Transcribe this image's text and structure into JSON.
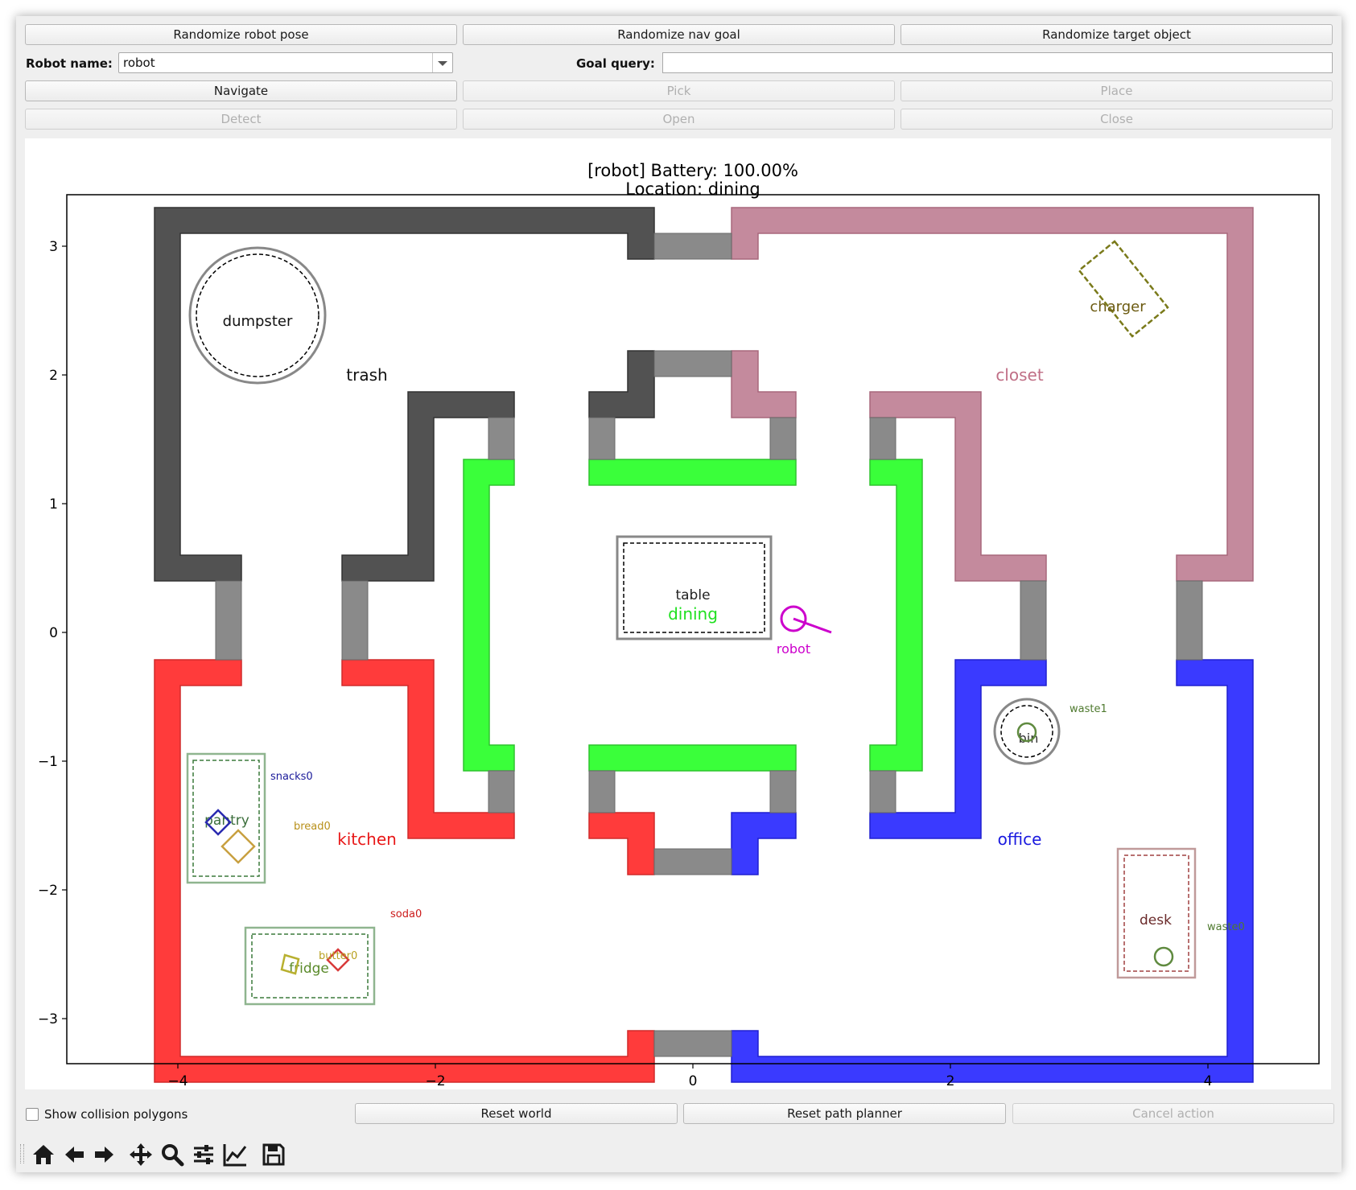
{
  "controls": {
    "randomize_pose": "Randomize robot pose",
    "randomize_goal": "Randomize nav goal",
    "randomize_object": "Randomize target object",
    "robot_name_label": "Robot name:",
    "robot_name_value": "robot",
    "goal_query_label": "Goal query:",
    "goal_query_value": "",
    "navigate": "Navigate",
    "pick": "Pick",
    "place": "Place",
    "detect": "Detect",
    "open": "Open",
    "close": "Close"
  },
  "plot": {
    "title_line1": "[robot] Battery: 100.00%",
    "title_line2": "Location: dining",
    "xticks": [
      "−4",
      "−2",
      "0",
      "2",
      "4"
    ],
    "yticks": [
      "3",
      "2",
      "1",
      "0",
      "−1",
      "−2",
      "−3"
    ],
    "rooms": {
      "trash": "trash",
      "closet": "closet",
      "kitchen": "kitchen",
      "office": "office",
      "dining": "dining"
    },
    "locations": {
      "dumpster": "dumpster",
      "charger": "charger",
      "table": "table",
      "bin": "bin",
      "pantry": "pantry",
      "fridge": "fridge",
      "desk": "desk"
    },
    "objects": {
      "snacks0": "snacks0",
      "bread0": "bread0",
      "soda0": "soda0",
      "butter0": "butter0",
      "waste0": "waste0",
      "waste1": "waste1"
    },
    "robot_label": "robot",
    "colors": {
      "trash": "#4f4f4f",
      "closet": "#c48a9d",
      "kitchen": "#ff3b3b",
      "office": "#3a3aff",
      "dining": "#3aff3a",
      "hallway": "#8a8a8a",
      "robot": "#cc00cc"
    }
  },
  "bottom": {
    "show_collision_label": "Show collision polygons",
    "reset_world": "Reset world",
    "reset_planner": "Reset path planner",
    "cancel_action": "Cancel action"
  },
  "toolbar": {
    "icons": [
      "home-icon",
      "back-arrow-icon",
      "forward-arrow-icon",
      "pan-icon",
      "zoom-icon",
      "configure-subplots-icon",
      "edit-axis-icon",
      "save-icon"
    ]
  }
}
